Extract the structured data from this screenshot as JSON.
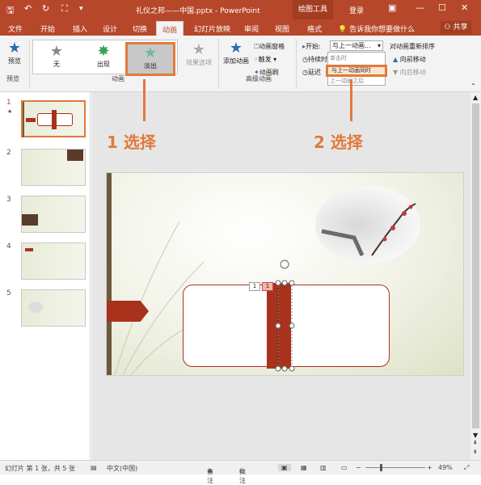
{
  "window": {
    "title": "礼仪之邦——中国.pptx - PowerPoint",
    "context_tab": "绘图工具",
    "login": "登录"
  },
  "tabs": [
    "文件",
    "开始",
    "插入",
    "设计",
    "切换",
    "动画",
    "幻灯片放映",
    "审阅",
    "视图",
    "格式"
  ],
  "active_tab": "动画",
  "tell_me": "告诉我你想要做什么",
  "share": "共享",
  "ribbon": {
    "preview": "预览",
    "preview_group": "预览",
    "effects": [
      "无",
      "出现",
      "淡出"
    ],
    "effect_options": "效果选项",
    "animation_group": "动画",
    "add_animation": "添加动画",
    "advanced": [
      "动画窗格",
      "触发",
      "动画刷"
    ],
    "advanced_group": "高级动画",
    "start_label": "开始:",
    "start_value": "与上一动画...",
    "duration_label": "持续时间",
    "delay_label": "延迟",
    "dropdown_options": [
      "单击时",
      "与上一动画同时",
      "上一动画之后"
    ],
    "selected_option": "与上一动画同时",
    "reorder": "对动画重新排序",
    "move_earlier": "向前移动",
    "move_later": "向后移动"
  },
  "annotations": [
    "1 选择",
    "2 选择"
  ],
  "slides": [
    {
      "number": "1"
    },
    {
      "number": "2"
    },
    {
      "number": "3"
    },
    {
      "number": "4"
    },
    {
      "number": "5"
    }
  ],
  "slide_tags": [
    "1",
    "1"
  ],
  "status": {
    "slide_info": "幻灯片 第 1 张，共 5 张",
    "language": "中文(中国)",
    "notes": "备注",
    "comments": "批注",
    "zoom": "49%"
  },
  "colors": {
    "accent": "#b7472a",
    "highlight": "#e07a3c",
    "ribbon_bg": "#f3f3f3"
  }
}
